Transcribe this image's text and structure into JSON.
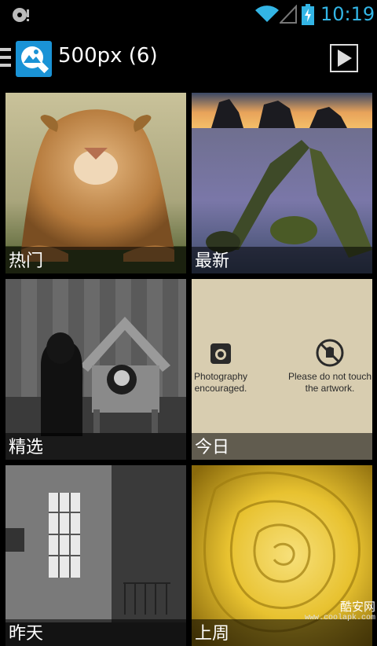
{
  "status_bar": {
    "time": "10:19",
    "accent_color": "#33b5e5",
    "icons": [
      "sd-card-icon",
      "wifi-icon",
      "signal-icon",
      "battery-charging-icon"
    ]
  },
  "action_bar": {
    "title": "500px (6)",
    "app_icon": "500px-app-icon",
    "menu_icon": "menu-icon",
    "slideshow_icon": "play-icon"
  },
  "tiles": [
    {
      "label": "热门",
      "image": "lion-photo"
    },
    {
      "label": "最新",
      "image": "seascape-rocks-photo"
    },
    {
      "label": "精选",
      "image": "dog-and-doghouse-photo"
    },
    {
      "label": "今日",
      "image": "gallery-sign-photo"
    },
    {
      "label": "昨天",
      "image": "abandoned-room-photo"
    },
    {
      "label": "上周",
      "image": "yellow-rose-photo"
    }
  ],
  "gallery_sign": {
    "left_text_line1": "Photography",
    "left_text_line2": "encouraged.",
    "right_text_line1": "Please do not touch",
    "right_text_line2": "the artwork."
  },
  "watermark": {
    "name": "酷安网",
    "url": "www.coolapk.com"
  }
}
